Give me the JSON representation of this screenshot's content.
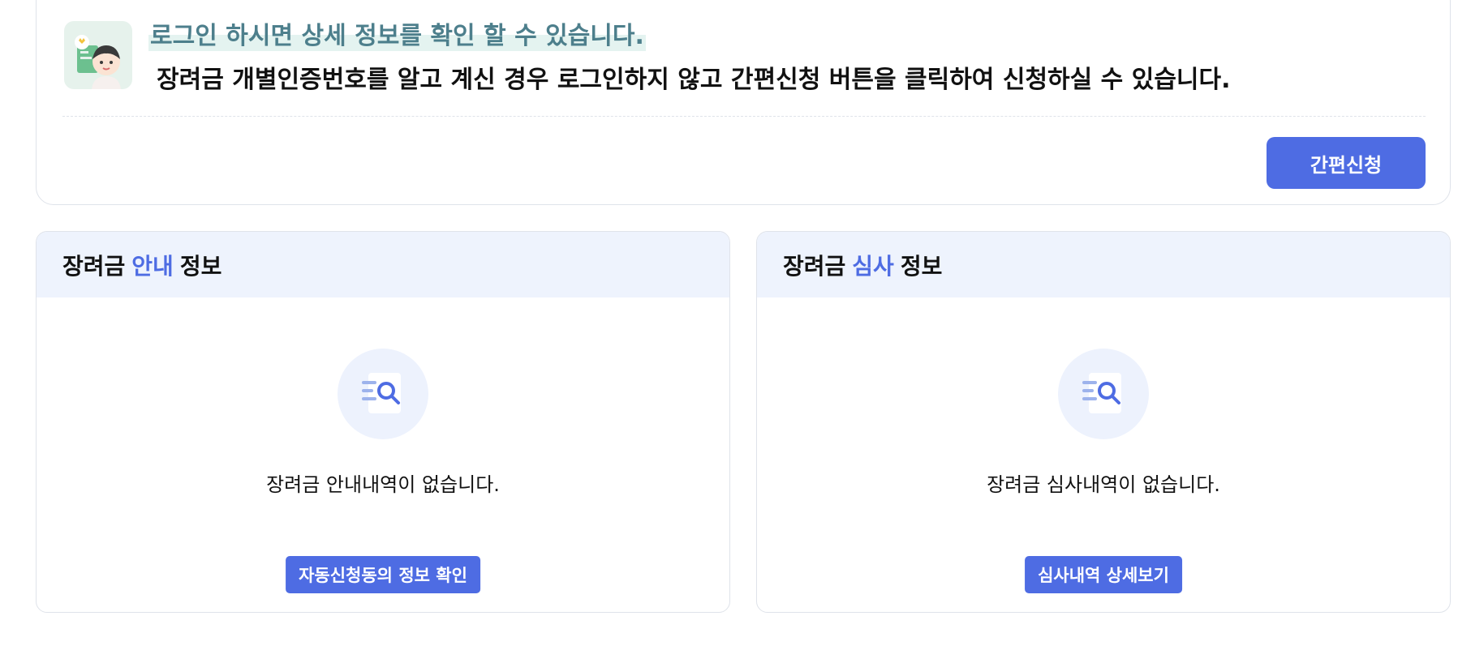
{
  "notice": {
    "title": "로그인 하시면 상세 정보를 확인 할 수 있습니다.",
    "description": "장려금 개별인증번호를 알고 계신 경우 로그인하지 않고 간편신청 버튼을 클릭하여 신청하실 수 있습니다.",
    "avatar_icon": "person-with-document-icon",
    "apply_button_label": "간편신청"
  },
  "panels": [
    {
      "title_prefix": "장려금",
      "title_accent": "안내",
      "title_suffix": "정보",
      "icon": "document-search-icon",
      "empty_message": "장려금 안내내역이 없습니다.",
      "button_label": "자동신청동의 정보 확인"
    },
    {
      "title_prefix": "장려금",
      "title_accent": "심사",
      "title_suffix": "정보",
      "icon": "document-search-icon",
      "empty_message": "장려금 심사내역이 없습니다.",
      "button_label": "심사내역 상세보기"
    }
  ],
  "colors": {
    "accent": "#4e6ce3",
    "notice_title": "#4d7f8c",
    "panel_header_bg": "#eef3fd",
    "border": "#dfe3ea"
  }
}
